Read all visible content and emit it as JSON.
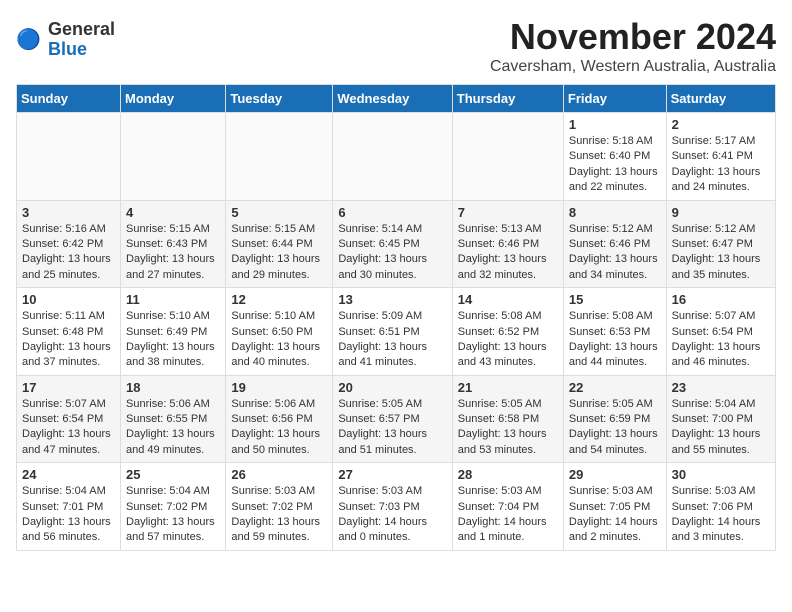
{
  "header": {
    "logo_line1": "General",
    "logo_line2": "Blue",
    "title": "November 2024",
    "subtitle": "Caversham, Western Australia, Australia"
  },
  "calendar": {
    "days_of_week": [
      "Sunday",
      "Monday",
      "Tuesday",
      "Wednesday",
      "Thursday",
      "Friday",
      "Saturday"
    ],
    "weeks": [
      [
        {
          "day": "",
          "info": ""
        },
        {
          "day": "",
          "info": ""
        },
        {
          "day": "",
          "info": ""
        },
        {
          "day": "",
          "info": ""
        },
        {
          "day": "",
          "info": ""
        },
        {
          "day": "1",
          "info": "Sunrise: 5:18 AM\nSunset: 6:40 PM\nDaylight: 13 hours and 22 minutes."
        },
        {
          "day": "2",
          "info": "Sunrise: 5:17 AM\nSunset: 6:41 PM\nDaylight: 13 hours and 24 minutes."
        }
      ],
      [
        {
          "day": "3",
          "info": "Sunrise: 5:16 AM\nSunset: 6:42 PM\nDaylight: 13 hours and 25 minutes."
        },
        {
          "day": "4",
          "info": "Sunrise: 5:15 AM\nSunset: 6:43 PM\nDaylight: 13 hours and 27 minutes."
        },
        {
          "day": "5",
          "info": "Sunrise: 5:15 AM\nSunset: 6:44 PM\nDaylight: 13 hours and 29 minutes."
        },
        {
          "day": "6",
          "info": "Sunrise: 5:14 AM\nSunset: 6:45 PM\nDaylight: 13 hours and 30 minutes."
        },
        {
          "day": "7",
          "info": "Sunrise: 5:13 AM\nSunset: 6:46 PM\nDaylight: 13 hours and 32 minutes."
        },
        {
          "day": "8",
          "info": "Sunrise: 5:12 AM\nSunset: 6:46 PM\nDaylight: 13 hours and 34 minutes."
        },
        {
          "day": "9",
          "info": "Sunrise: 5:12 AM\nSunset: 6:47 PM\nDaylight: 13 hours and 35 minutes."
        }
      ],
      [
        {
          "day": "10",
          "info": "Sunrise: 5:11 AM\nSunset: 6:48 PM\nDaylight: 13 hours and 37 minutes."
        },
        {
          "day": "11",
          "info": "Sunrise: 5:10 AM\nSunset: 6:49 PM\nDaylight: 13 hours and 38 minutes."
        },
        {
          "day": "12",
          "info": "Sunrise: 5:10 AM\nSunset: 6:50 PM\nDaylight: 13 hours and 40 minutes."
        },
        {
          "day": "13",
          "info": "Sunrise: 5:09 AM\nSunset: 6:51 PM\nDaylight: 13 hours and 41 minutes."
        },
        {
          "day": "14",
          "info": "Sunrise: 5:08 AM\nSunset: 6:52 PM\nDaylight: 13 hours and 43 minutes."
        },
        {
          "day": "15",
          "info": "Sunrise: 5:08 AM\nSunset: 6:53 PM\nDaylight: 13 hours and 44 minutes."
        },
        {
          "day": "16",
          "info": "Sunrise: 5:07 AM\nSunset: 6:54 PM\nDaylight: 13 hours and 46 minutes."
        }
      ],
      [
        {
          "day": "17",
          "info": "Sunrise: 5:07 AM\nSunset: 6:54 PM\nDaylight: 13 hours and 47 minutes."
        },
        {
          "day": "18",
          "info": "Sunrise: 5:06 AM\nSunset: 6:55 PM\nDaylight: 13 hours and 49 minutes."
        },
        {
          "day": "19",
          "info": "Sunrise: 5:06 AM\nSunset: 6:56 PM\nDaylight: 13 hours and 50 minutes."
        },
        {
          "day": "20",
          "info": "Sunrise: 5:05 AM\nSunset: 6:57 PM\nDaylight: 13 hours and 51 minutes."
        },
        {
          "day": "21",
          "info": "Sunrise: 5:05 AM\nSunset: 6:58 PM\nDaylight: 13 hours and 53 minutes."
        },
        {
          "day": "22",
          "info": "Sunrise: 5:05 AM\nSunset: 6:59 PM\nDaylight: 13 hours and 54 minutes."
        },
        {
          "day": "23",
          "info": "Sunrise: 5:04 AM\nSunset: 7:00 PM\nDaylight: 13 hours and 55 minutes."
        }
      ],
      [
        {
          "day": "24",
          "info": "Sunrise: 5:04 AM\nSunset: 7:01 PM\nDaylight: 13 hours and 56 minutes."
        },
        {
          "day": "25",
          "info": "Sunrise: 5:04 AM\nSunset: 7:02 PM\nDaylight: 13 hours and 57 minutes."
        },
        {
          "day": "26",
          "info": "Sunrise: 5:03 AM\nSunset: 7:02 PM\nDaylight: 13 hours and 59 minutes."
        },
        {
          "day": "27",
          "info": "Sunrise: 5:03 AM\nSunset: 7:03 PM\nDaylight: 14 hours and 0 minutes."
        },
        {
          "day": "28",
          "info": "Sunrise: 5:03 AM\nSunset: 7:04 PM\nDaylight: 14 hours and 1 minute."
        },
        {
          "day": "29",
          "info": "Sunrise: 5:03 AM\nSunset: 7:05 PM\nDaylight: 14 hours and 2 minutes."
        },
        {
          "day": "30",
          "info": "Sunrise: 5:03 AM\nSunset: 7:06 PM\nDaylight: 14 hours and 3 minutes."
        }
      ]
    ]
  }
}
